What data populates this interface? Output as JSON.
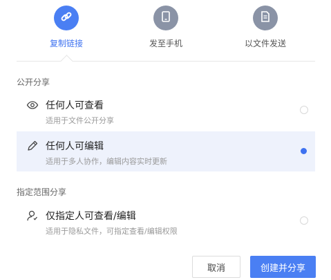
{
  "tabs": [
    {
      "label": "复制链接",
      "icon": "link-icon",
      "active": true,
      "color": "#4a7ff3"
    },
    {
      "label": "发至手机",
      "icon": "phone-icon",
      "active": false,
      "color": "#8a93a6"
    },
    {
      "label": "以文件发送",
      "icon": "document-icon",
      "active": false,
      "color": "#8a93a6"
    }
  ],
  "public_section": {
    "title": "公开分享",
    "options": [
      {
        "title": "任何人可查看",
        "desc": "适用于文件公开分享",
        "icon": "eye-icon",
        "selected": false
      },
      {
        "title": "任何人可编辑",
        "desc": "适用于多人协作，编辑内容实时更新",
        "icon": "pencil-icon",
        "selected": true
      }
    ]
  },
  "specified_section": {
    "title": "指定范围分享",
    "options": [
      {
        "title": "仅指定人可查看/编辑",
        "desc": "适用于隐私文件，可指定查看/编辑权限",
        "icon": "user-icon",
        "selected": false
      }
    ]
  },
  "buttons": {
    "cancel": "取消",
    "create": "创建并分享"
  },
  "colors": {
    "accent": "#4a7ff3",
    "selected_bg": "#eef2fc"
  }
}
